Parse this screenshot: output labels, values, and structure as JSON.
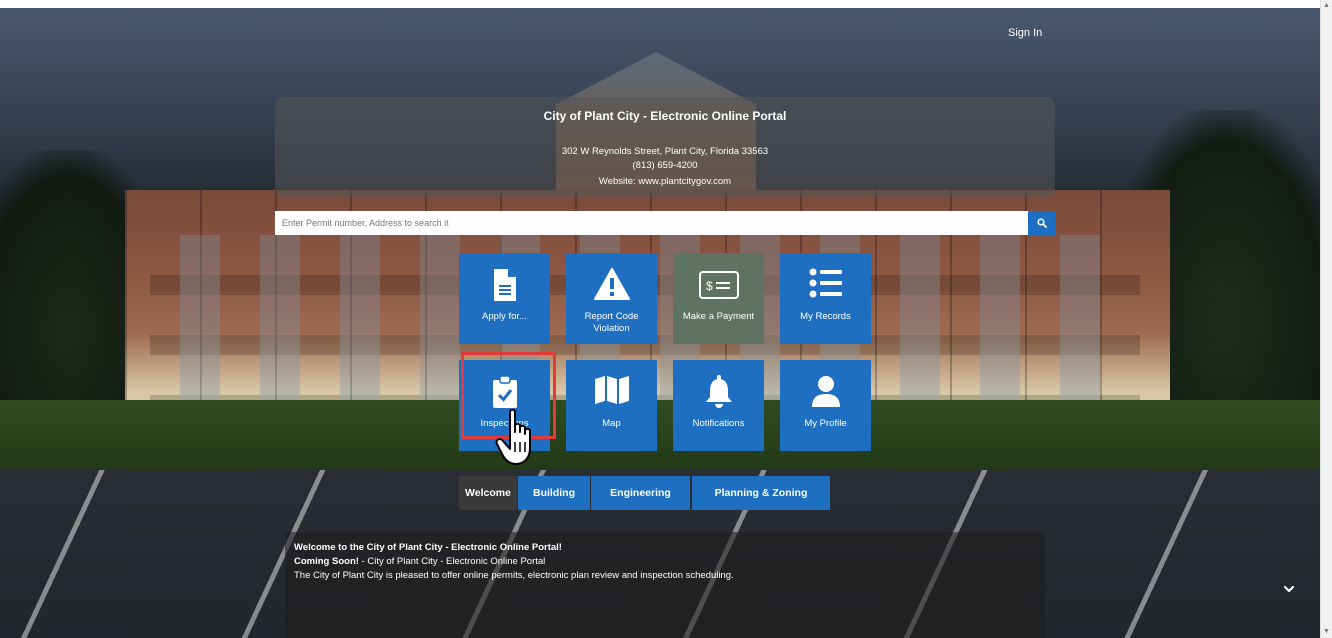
{
  "header": {
    "sign_in": "Sign In",
    "title": "City of Plant City - Electronic Online Portal",
    "address": "302 W Reynolds Street, Plant City, Florida 33563",
    "phone": "(813) 659-4200",
    "website": "Website: www.plantcitygov.com"
  },
  "search": {
    "placeholder": "Enter Permit number, Address to search it",
    "button_icon": "search-icon"
  },
  "tiles": [
    {
      "label": "Apply for...",
      "icon": "document-icon"
    },
    {
      "label": "Report Code Violation",
      "icon": "warning-icon"
    },
    {
      "label": "Make a Payment",
      "icon": "money-icon"
    },
    {
      "label": "My Records",
      "icon": "list-icon"
    },
    {
      "label": "Inspections",
      "icon": "clipboard-check-icon"
    },
    {
      "label": "Map",
      "icon": "map-icon"
    },
    {
      "label": "Notifications",
      "icon": "bell-icon"
    },
    {
      "label": "My Profile",
      "icon": "user-icon"
    }
  ],
  "tabs": [
    {
      "label": "Welcome",
      "active": true
    },
    {
      "label": "Building",
      "active": false
    },
    {
      "label": "Engineering",
      "active": false
    },
    {
      "label": "Planning & Zoning",
      "active": false
    }
  ],
  "welcome": {
    "heading": "Welcome to the City of Plant City - Electronic Online Portal!",
    "coming_soon_label": "Coming Soon!",
    "coming_soon_text": " - City of Plant City - Electronic Online Portal",
    "description": "The City of Plant City is pleased to offer online permits, electronic plan review and inspection scheduling."
  },
  "colors": {
    "tile_blue": "#1e6fc2",
    "tile_gray": "#5e7363",
    "tab_active": "#3a3a3a",
    "highlight": "#e23b3b"
  }
}
